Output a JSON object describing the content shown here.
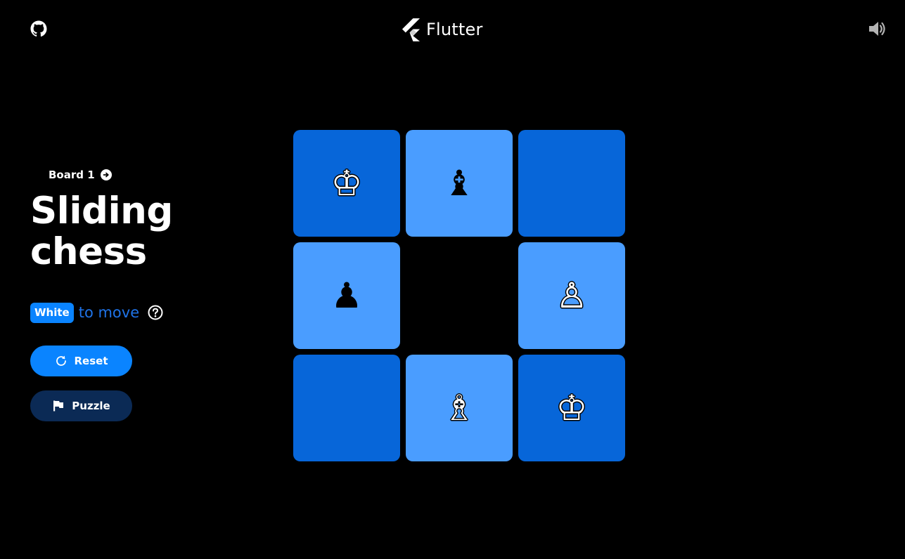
{
  "header": {
    "logo_text": "Flutter",
    "github_icon": "github-icon",
    "audio_icon": "volume-icon"
  },
  "panel": {
    "board_label": "Board 1",
    "title_line1": "Sliding",
    "title_line2": "chess",
    "turn_badge": "White",
    "turn_text": "to move",
    "reset_label": "Reset",
    "puzzle_label": "Puzzle"
  },
  "colors": {
    "background": "#000000",
    "accent": "#0a84ff",
    "tile_dark": "#0766d9",
    "tile_light": "#4a9dff",
    "puzzle_button": "#0b2a55",
    "turn_text": "#1f73e8"
  },
  "board": {
    "rows": 3,
    "cols": 3,
    "tiles": [
      {
        "row": 0,
        "col": 0,
        "shade": "dark",
        "piece": "king",
        "piece_color": "white",
        "glyph": "♔"
      },
      {
        "row": 0,
        "col": 1,
        "shade": "light",
        "piece": "bishop",
        "piece_color": "black",
        "glyph": "♝"
      },
      {
        "row": 0,
        "col": 2,
        "shade": "dark",
        "piece": "",
        "piece_color": "",
        "glyph": ""
      },
      {
        "row": 1,
        "col": 0,
        "shade": "light",
        "piece": "pawn",
        "piece_color": "black",
        "glyph": "♟"
      },
      {
        "row": 1,
        "col": 2,
        "shade": "light",
        "piece": "pawn",
        "piece_color": "white",
        "glyph": "♙"
      },
      {
        "row": 2,
        "col": 0,
        "shade": "dark",
        "piece": "",
        "piece_color": "",
        "glyph": ""
      },
      {
        "row": 2,
        "col": 1,
        "shade": "light",
        "piece": "bishop",
        "piece_color": "white",
        "glyph": "♗"
      },
      {
        "row": 2,
        "col": 2,
        "shade": "dark",
        "piece": "king",
        "piece_color": "white",
        "glyph": "♔"
      }
    ],
    "empty_cell": {
      "row": 1,
      "col": 1
    }
  }
}
